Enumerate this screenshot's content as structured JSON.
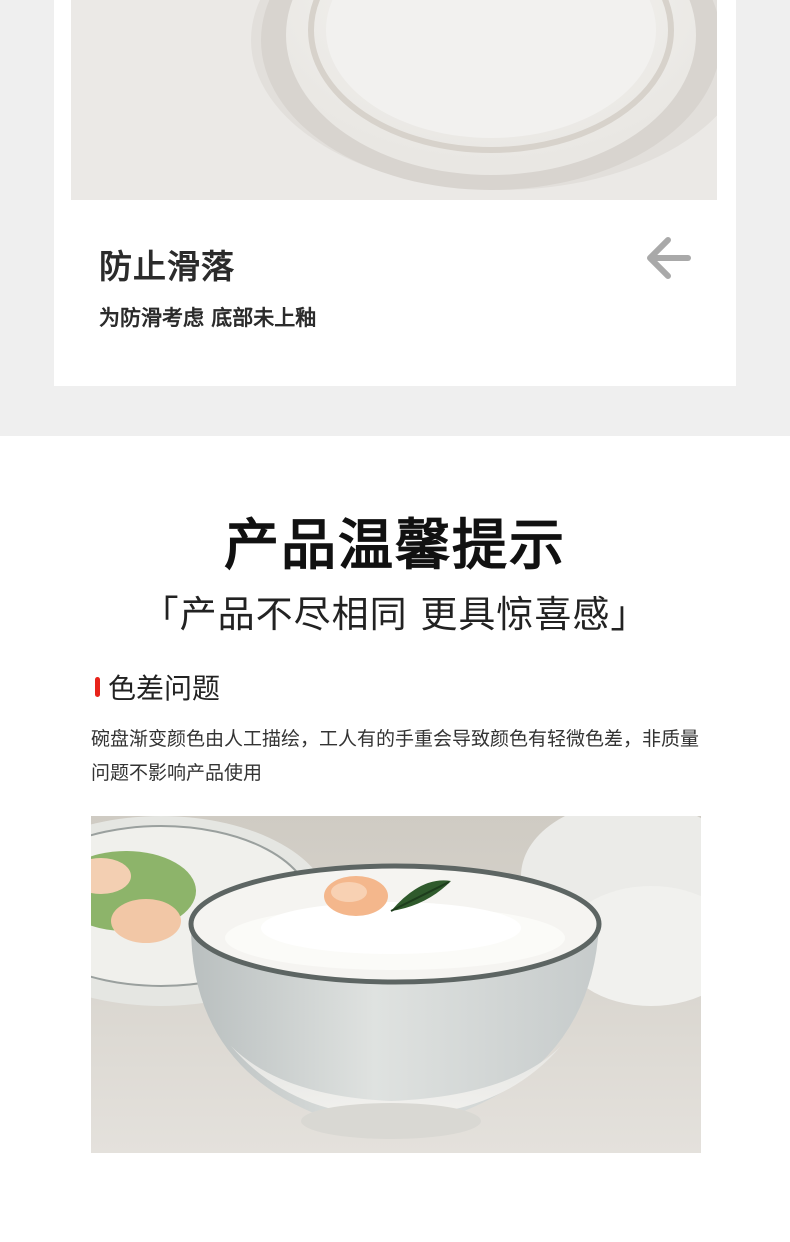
{
  "feature": {
    "title": "防止滑落",
    "subtitle": "为防滑考虑 底部未上釉"
  },
  "notice": {
    "title": "产品温馨提示",
    "subtitle": "「产品不尽相同 更具惊喜感」"
  },
  "issue": {
    "heading": "色差问题",
    "text": "碗盘渐变颜色由人工描绘，工人有的手重会导致颜色有轻微色差，非质量问题不影响产品使用"
  },
  "icons": {
    "arrow": "arrow-left-icon"
  },
  "colors": {
    "accent": "#e8231b",
    "band_bg": "#efefef"
  }
}
